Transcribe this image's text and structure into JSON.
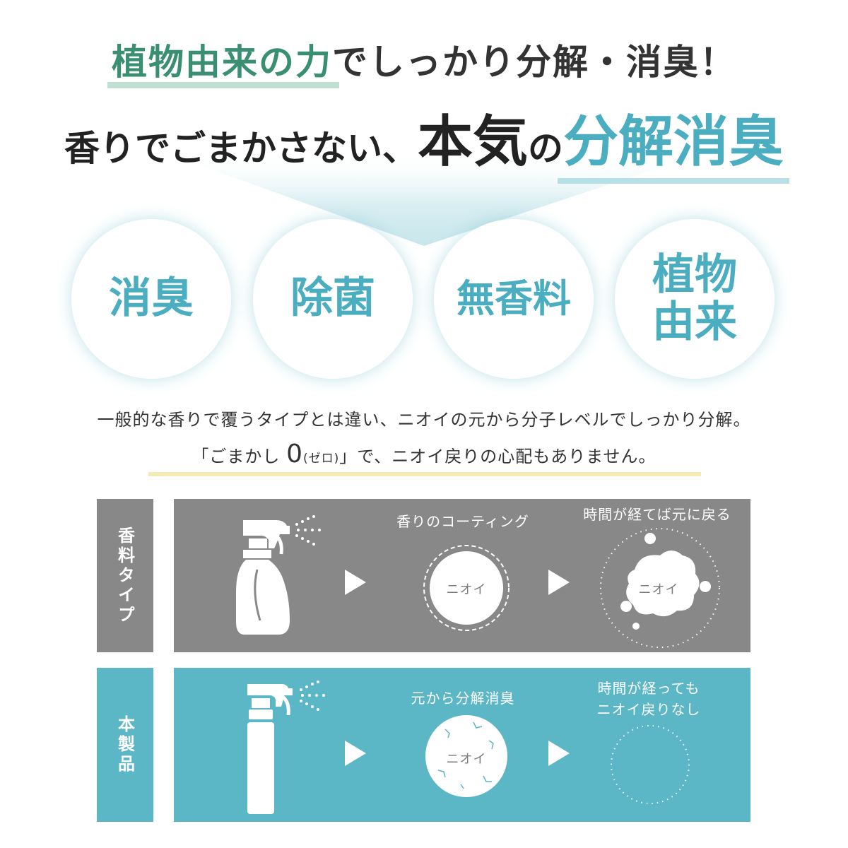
{
  "headline": {
    "line1_green": "植物由来の力",
    "line1_rest": "でしっかり分解・消臭！",
    "line2_prefix": "香りでごまかさない、",
    "line2_big": "本気",
    "line2_no": "の",
    "line2_teal": "分解消臭"
  },
  "features": [
    {
      "line1": "消臭",
      "line2": ""
    },
    {
      "line1": "除菌",
      "line2": ""
    },
    {
      "line1": "無香料",
      "line2": ""
    },
    {
      "line1": "植物",
      "line2": "由来"
    }
  ],
  "description": {
    "line1": "一般的な香りで覆うタイプとは違い、ニオイの元から分子レベルでしっかり分解。",
    "line2_a": "「ごまかし",
    "line2_zero": "0",
    "line2_paren": "(ゼロ)",
    "line2_b": "」で、ニオイ戻りの心配もありません。"
  },
  "comparison": {
    "fragrance": {
      "label": "香料タイプ",
      "step1": "香りのコーティング",
      "step2": "時間が経てば元に戻る",
      "circle1": "ニオイ",
      "circle2": "ニオイ"
    },
    "product": {
      "label": "本製品",
      "step1": "元から分解消臭",
      "step2_line1": "時間が経っても",
      "step2_line2": "ニオイ戻りなし",
      "circle1": "ニオイ"
    }
  },
  "colors": {
    "green": "#3a8f72",
    "teal": "#4aaec0",
    "gray_panel": "#888888",
    "teal_panel": "#5bb6c6",
    "yellow_underline": "#f4eab4"
  },
  "icons": [
    "spray-bottle-icon",
    "trigger-spray-bottle-icon",
    "arrow-right-icon"
  ]
}
